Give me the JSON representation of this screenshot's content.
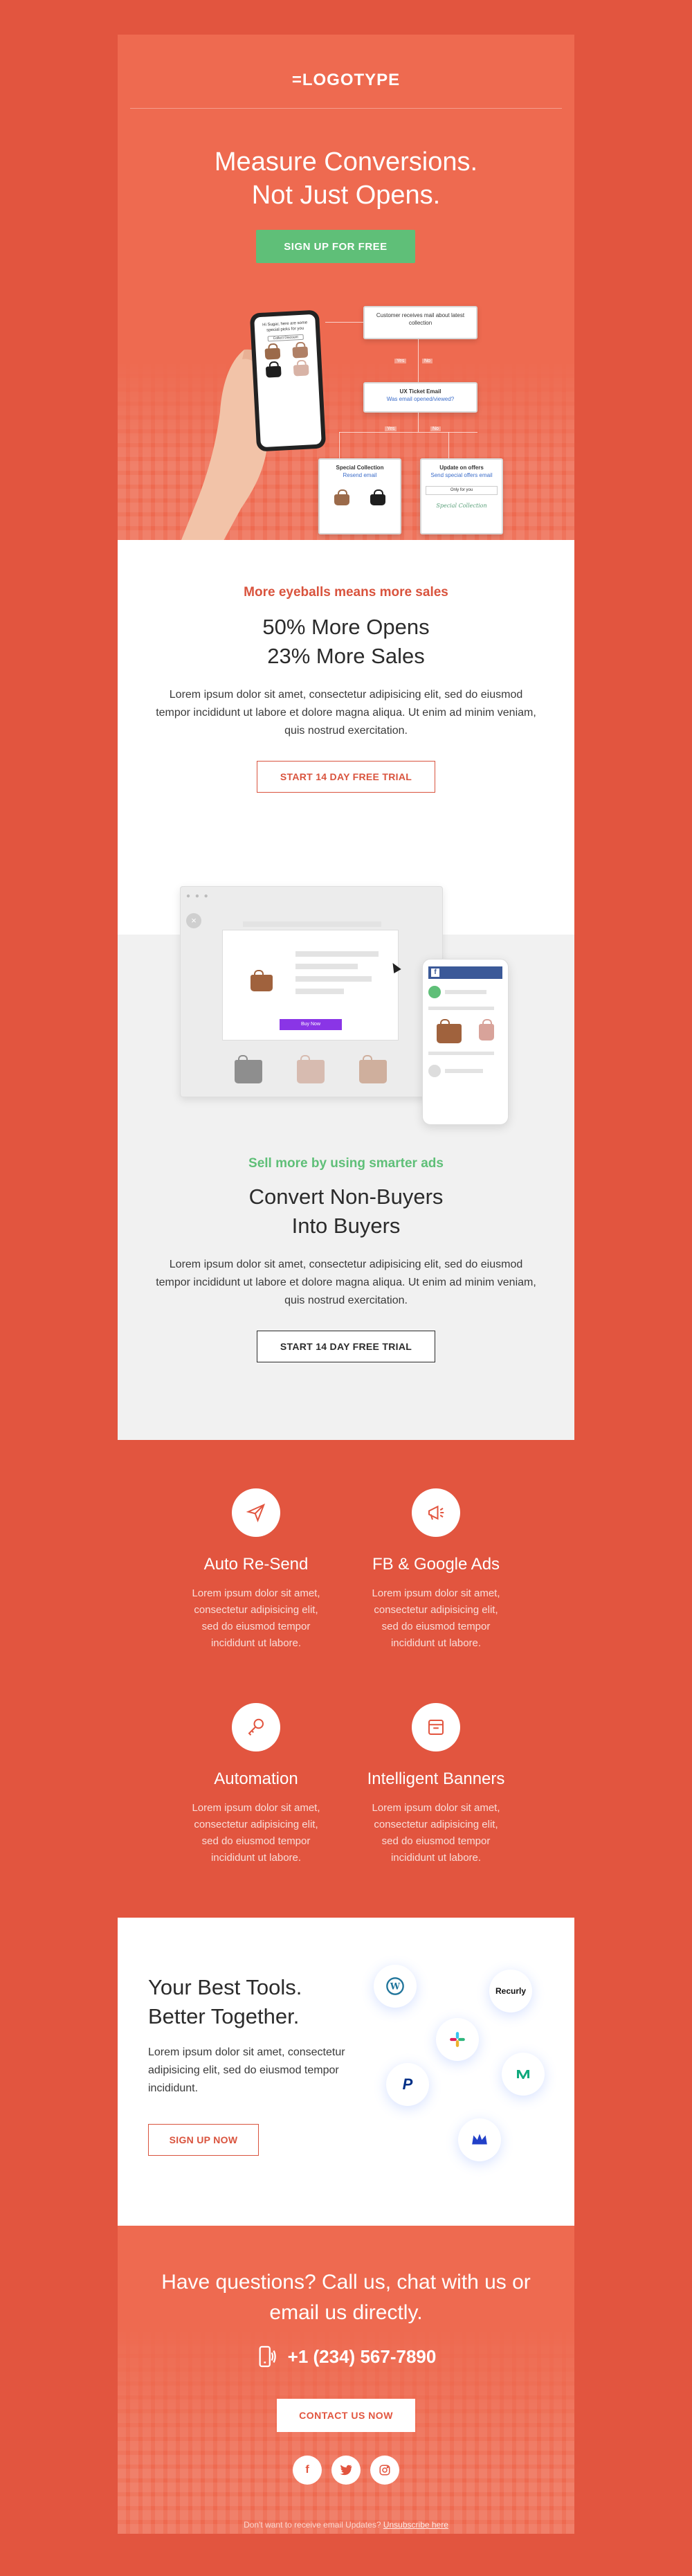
{
  "header": {
    "logo": "=LOGOTYPE"
  },
  "hero": {
    "title_line1": "Measure Conversions.",
    "title_line2": "Not Just Opens.",
    "cta": "SIGN UP FOR FREE",
    "phone_text": "Hi Sugar, here are some special picks for you",
    "phone_button": "Collect Discount",
    "flow": {
      "box1": "Customer receives mail about latest collection",
      "yes": "Yes",
      "no": "No",
      "box2_title": "UX Ticket Email",
      "box2_sub": "Was email opened/viewed?",
      "box3_title": "Special Collection",
      "box3_sub": "Resend email",
      "box4_title": "Update on offers",
      "box4_sub": "Send special offers email",
      "box4_tag": "Only for you",
      "box4_script": "Special Collection"
    }
  },
  "section_opens": {
    "kicker": "More eyeballs means more sales",
    "line1": "50% More Opens",
    "line2": "23% More Sales",
    "body": "Lorem ipsum dolor sit amet, consectetur adipisicing elit, sed do eiusmod tempor incididunt ut labore et dolore magna aliqua. Ut enim ad minim veniam, quis nostrud exercitation.",
    "cta": "START 14 DAY FREE TRIAL"
  },
  "section_ads": {
    "kicker": "Sell more by using smarter ads",
    "line1": "Convert Non-Buyers",
    "line2": "Into Buyers",
    "body": "Lorem ipsum dolor sit amet, consectetur adipisicing elit, sed do eiusmod tempor incididunt ut labore et dolore magna aliqua. Ut enim ad minim veniam, quis nostrud exercitation.",
    "cta": "START 14 DAY FREE TRIAL",
    "mock_buy": "Buy Now"
  },
  "features": [
    {
      "title": "Auto Re-Send",
      "text": "Lorem ipsum dolor sit amet, consectetur adipisicing elit, sed do eiusmod tempor incididunt ut labore.",
      "icon": "paper-plane-icon"
    },
    {
      "title": "FB & Google Ads",
      "text": "Lorem ipsum dolor sit amet, consectetur adipisicing elit, sed do eiusmod tempor incididunt ut labore.",
      "icon": "megaphone-icon"
    },
    {
      "title": "Automation",
      "text": "Lorem ipsum dolor sit amet, consectetur adipisicing elit, sed do eiusmod tempor incididunt ut labore.",
      "icon": "key-icon"
    },
    {
      "title": "Intelligent Banners",
      "text": "Lorem ipsum dolor sit amet, consectetur adipisicing elit, sed do eiusmod tempor incididunt ut labore.",
      "icon": "banner-icon"
    }
  ],
  "tools": {
    "line1": "Your Best Tools.",
    "line2": "Better Together.",
    "body": "Lorem ipsum dolor sit amet, consectetur adipisicing elit, sed do eiusmod tempor incididunt.",
    "cta": "SIGN UP NOW",
    "recurly": "Recurly"
  },
  "contact": {
    "title": "Have questions? Call us, chat with us or email us directly.",
    "phone": "+1 (234) 567-7890",
    "cta": "CONTACT US NOW"
  },
  "footer": {
    "text": "Don't want to receive email Updates?",
    "link": "Unsubscribe here"
  },
  "colors": {
    "background": "#e2553f",
    "hero": "#ee6a50",
    "green": "#5fbf78",
    "accent_red": "#d9533d",
    "dark": "#2b2b2b"
  }
}
